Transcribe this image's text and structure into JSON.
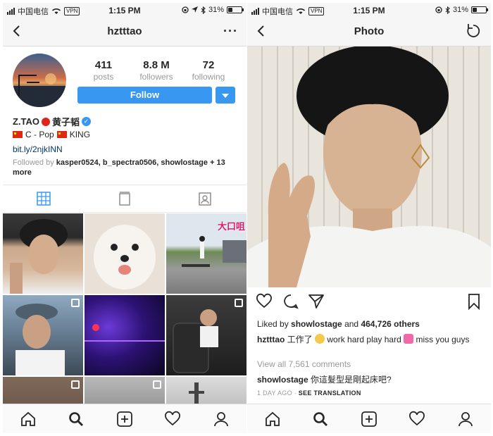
{
  "status_bar": {
    "carrier": "中国电信",
    "vpn": "VPN",
    "time": "1:15 PM",
    "battery": "31%",
    "battery_level": 0.31
  },
  "profile_screen": {
    "username": "hztttao",
    "more_icon": "···",
    "stats": [
      {
        "value": "411",
        "label": "posts"
      },
      {
        "value": "8.8 M",
        "label": "followers"
      },
      {
        "value": "72",
        "label": "following"
      }
    ],
    "follow_label": "Follow",
    "name_prefix": "Z.TAO",
    "name_suffix": "黄子韬",
    "bio_text": "C - Pop",
    "bio_text_2": "KING",
    "link": "bit.ly/2njkINN",
    "followed_by_prefix": "Followed by",
    "followed_by_users": "kasper0524, b_spectra0506, showlostage",
    "followed_by_more": "+ 13 more",
    "grid_overlay_text": "大口咀"
  },
  "photo_screen": {
    "title": "Photo",
    "liked_by_prefix": "Liked by",
    "liked_by_user": "showlostage",
    "liked_by_and": "and",
    "liked_by_count": "464,726 others",
    "caption_user": "hztttao",
    "caption_text_1": "工作了",
    "caption_text_2": "work hard play hard",
    "caption_text_3": "miss you guys",
    "view_all": "View all 7,561 comments",
    "comment_user": "showlostage",
    "comment_text": "你這髮型是剛起床吧?",
    "time_ago": "1 DAY AGO",
    "see_translation": "SEE TRANSLATION"
  },
  "colors": {
    "accent": "#3897f0",
    "text": "#262626",
    "muted": "#999999",
    "link": "#003569"
  }
}
